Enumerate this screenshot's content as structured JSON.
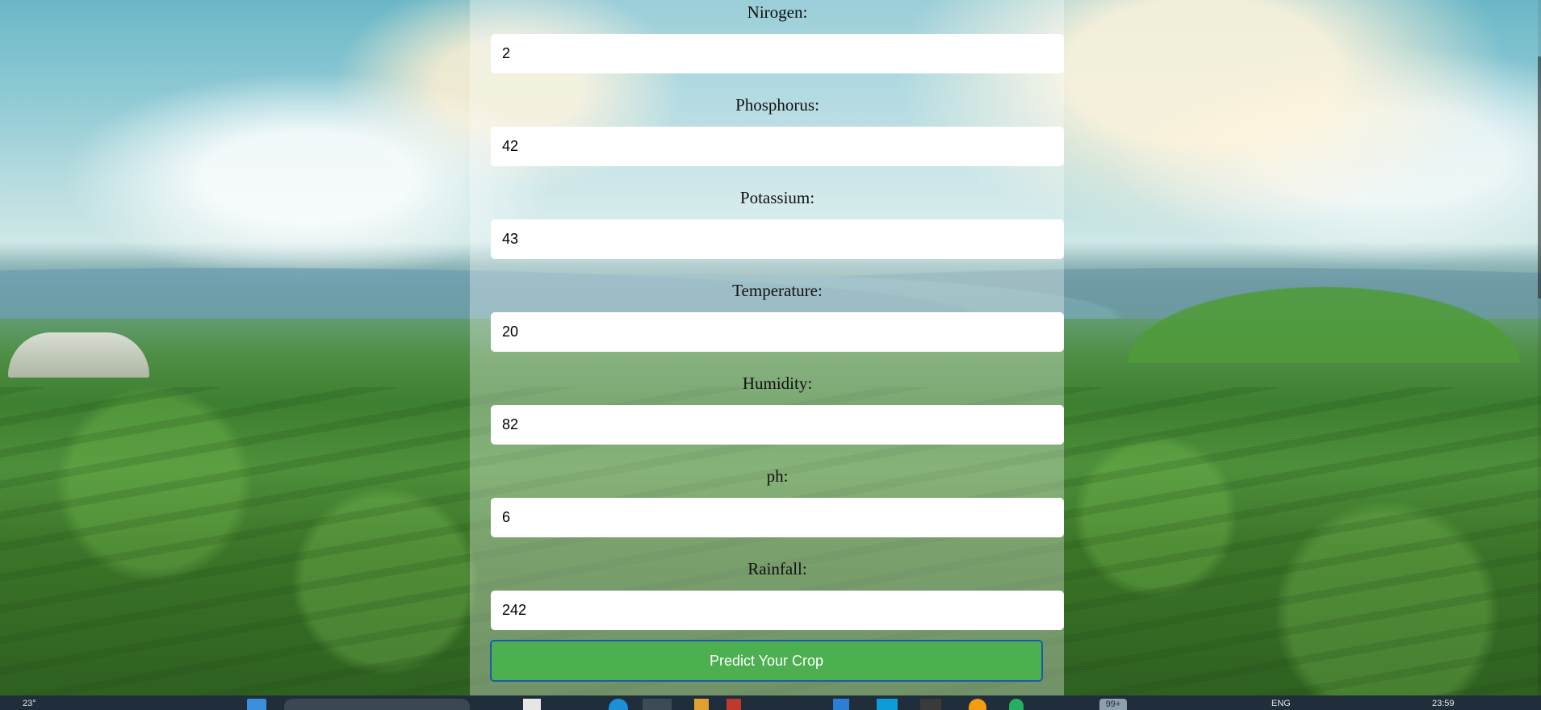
{
  "form": {
    "fields": [
      {
        "label": "Nirogen:",
        "value": "2"
      },
      {
        "label": "Phosphorus:",
        "value": "42"
      },
      {
        "label": "Potassium:",
        "value": "43"
      },
      {
        "label": "Temperature:",
        "value": "20"
      },
      {
        "label": "Humidity:",
        "value": "82"
      },
      {
        "label": "ph:",
        "value": "6"
      },
      {
        "label": "Rainfall:",
        "value": "242"
      }
    ],
    "submit_label": "Predict Your Crop"
  },
  "taskbar": {
    "weather": "23°",
    "badge": "99+",
    "language": "ENG",
    "time": "23:59"
  },
  "colors": {
    "button": "#4caf50",
    "button_border": "#1e5aa8"
  }
}
